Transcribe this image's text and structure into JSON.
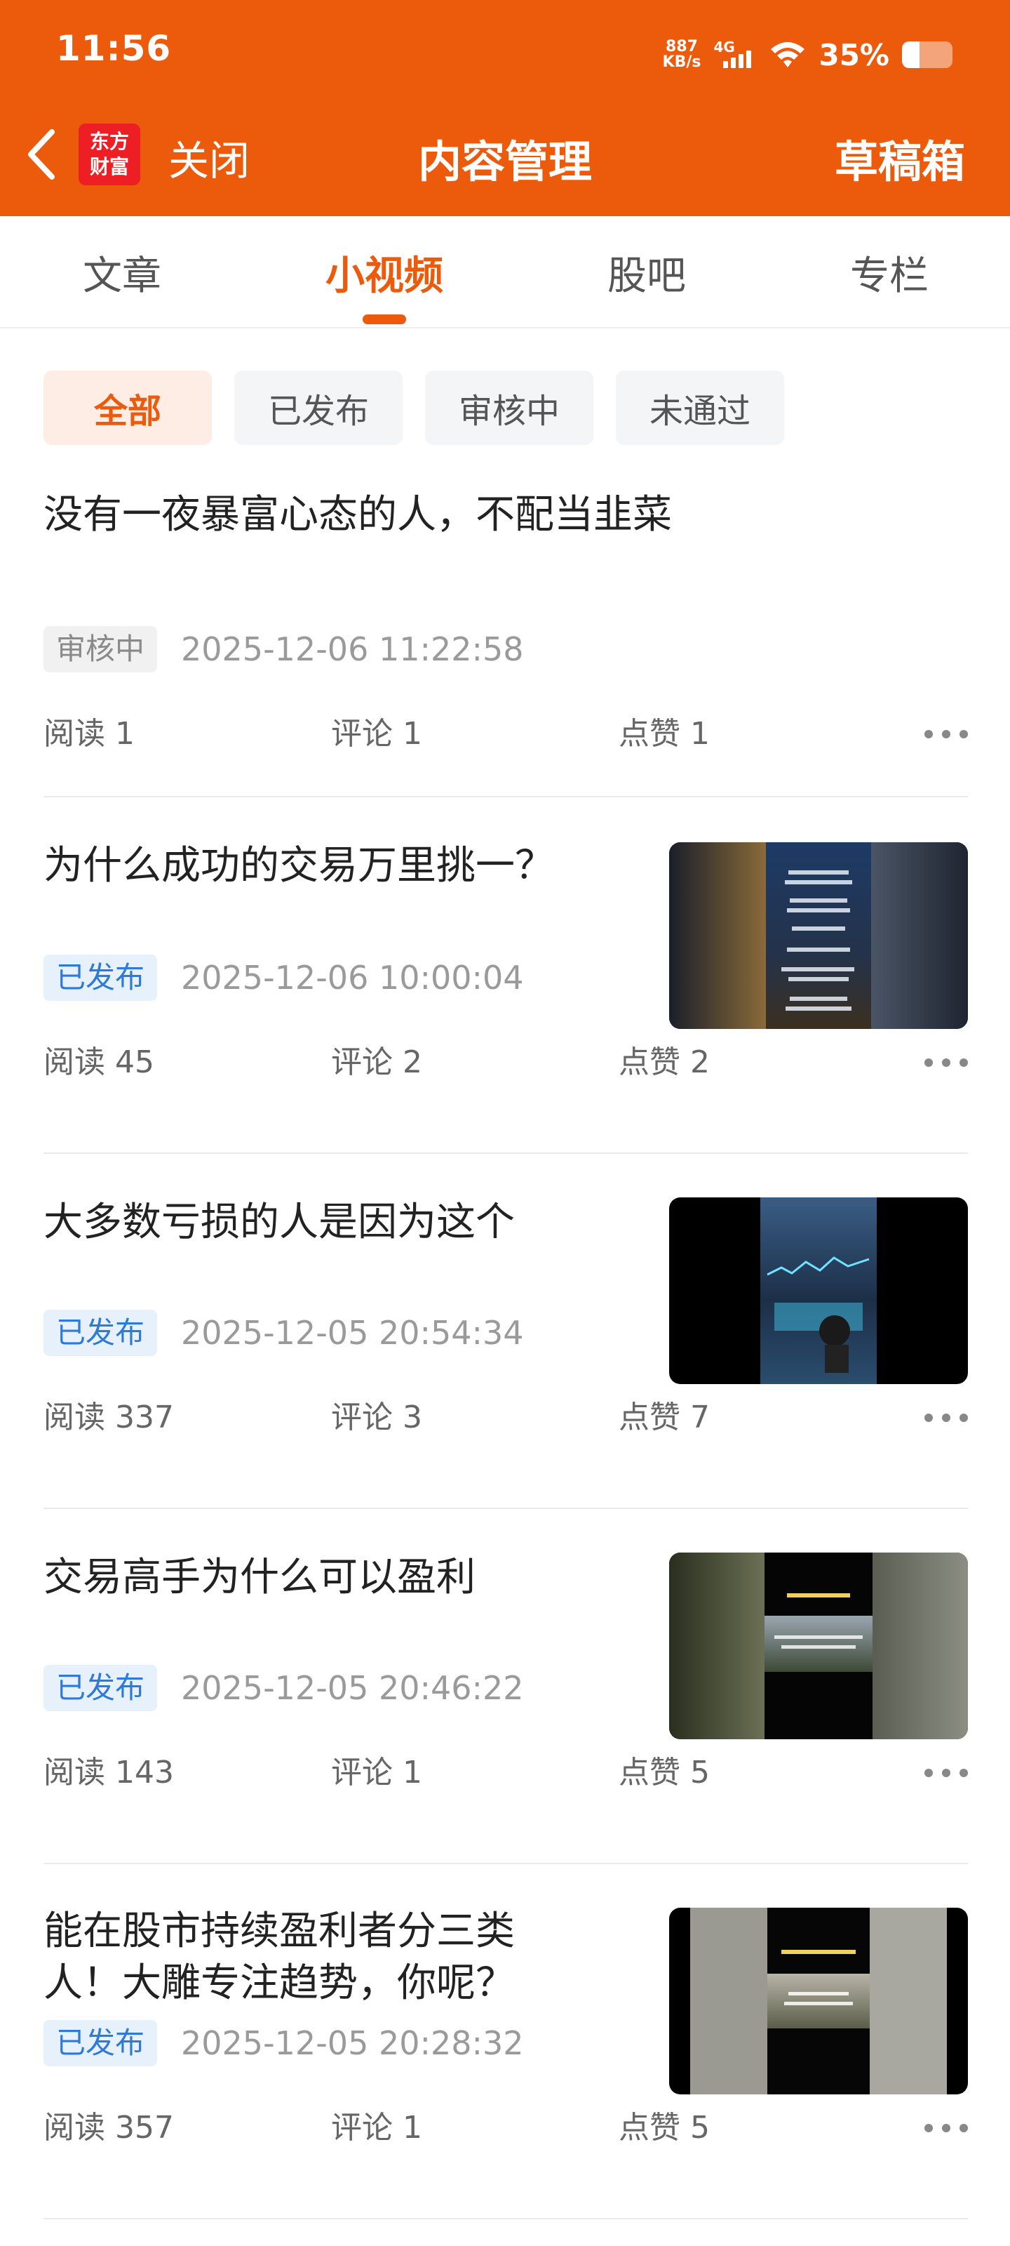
{
  "status": {
    "time": "11:56",
    "net_speed_value": "887",
    "net_speed_unit": "KB/s",
    "network": "4G",
    "battery": "35%",
    "battery_level": 0.35
  },
  "nav": {
    "logo_line1": "东方",
    "logo_line2": "财富",
    "close": "关闭",
    "title": "内容管理",
    "drafts": "草稿箱"
  },
  "tabs": [
    {
      "label": "文章"
    },
    {
      "label": "小视频",
      "active": true
    },
    {
      "label": "股吧"
    },
    {
      "label": "专栏"
    }
  ],
  "filters": [
    {
      "label": "全部",
      "active": true
    },
    {
      "label": "已发布"
    },
    {
      "label": "审核中"
    },
    {
      "label": "未通过"
    }
  ],
  "items": [
    {
      "title": "没有一夜暴富心态的人，不配当韭菜",
      "status": "审核中",
      "datetime": "2025-12-06 11:22:58",
      "reads": "阅读 1",
      "comments": "评论 1",
      "likes": "点赞 1"
    },
    {
      "title": "为什么成功的交易万里挑一？",
      "status": "已发布",
      "datetime": "2025-12-06 10:00:04",
      "reads": "阅读 45",
      "comments": "评论 2",
      "likes": "点赞 2"
    },
    {
      "title": "大多数亏损的人是因为这个",
      "status": "已发布",
      "datetime": "2025-12-05 20:54:34",
      "reads": "阅读 337",
      "comments": "评论 3",
      "likes": "点赞 7"
    },
    {
      "title": "交易高手为什么可以盈利",
      "status": "已发布",
      "datetime": "2025-12-05 20:46:22",
      "reads": "阅读 143",
      "comments": "评论 1",
      "likes": "点赞 5"
    },
    {
      "title_line1": "能在股市持续盈利者分三类",
      "title_line2": "人！大雕专注趋势，你呢？",
      "status": "已发布",
      "datetime": "2025-12-05 20:28:32",
      "reads": "阅读 357",
      "comments": "评论 1",
      "likes": "点赞 5"
    }
  ],
  "colors": {
    "brand": "#EC5A0C",
    "published_badge": "#2E7AD8",
    "review_badge": "#8a8a8a"
  }
}
